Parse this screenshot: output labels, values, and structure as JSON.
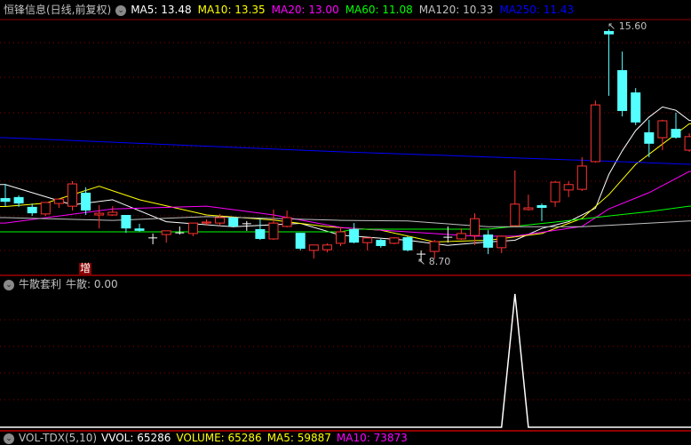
{
  "main_header": {
    "title": "恒锋信息(日线,前复权)",
    "ma": [
      {
        "label": "MA5: 13.48",
        "color": "#ffffff"
      },
      {
        "label": "MA10: 13.35",
        "color": "#ffff00"
      },
      {
        "label": "MA20: 13.00",
        "color": "#ff00ff"
      },
      {
        "label": "MA60: 11.08",
        "color": "#00ff00"
      },
      {
        "label": "MA120: 10.33",
        "color": "#c0c0c0"
      },
      {
        "label": "MA250: 11.43",
        "color": "#0000ff"
      }
    ]
  },
  "indicator_header": {
    "title": "牛散套利",
    "value": "牛散: 0.00"
  },
  "volume_header": {
    "title": "VOL-TDX(5,10)",
    "items": [
      {
        "label": "VVOL: 65286",
        "color": "#ffffff"
      },
      {
        "label": "VOLUME: 65286",
        "color": "#ffff00"
      },
      {
        "label": "MA5: 59887",
        "color": "#ffff00"
      },
      {
        "label": "MA10: 73873",
        "color": "#ff00ff"
      }
    ]
  },
  "marker": "增",
  "chart_data": [
    {
      "type": "candlestick",
      "high_label": "15.60",
      "low_label": "8.70",
      "colors": {
        "up": "#ff3232",
        "down": "#54ffff",
        "flat": "#ffffff",
        "grid": "#8b0000"
      },
      "ohlc": [
        [
          10.6,
          11.02,
          10.36,
          10.49
        ],
        [
          10.63,
          10.68,
          10.34,
          10.44
        ],
        [
          10.34,
          10.44,
          10.07,
          10.15
        ],
        [
          10.13,
          10.47,
          10.07,
          10.47
        ],
        [
          10.44,
          10.57,
          10.31,
          10.57
        ],
        [
          10.36,
          11.1,
          10.23,
          11.02
        ],
        [
          10.76,
          10.92,
          10.1,
          10.23
        ],
        [
          10.1,
          10.39,
          9.7,
          10.15
        ],
        [
          10.1,
          10.36,
          10.07,
          10.18
        ],
        [
          10.1,
          10.1,
          9.57,
          9.7
        ],
        [
          9.7,
          9.84,
          9.6,
          9.63
        ],
        [
          9.42,
          9.55,
          9.23,
          9.42
        ],
        [
          9.52,
          9.63,
          9.28,
          9.63
        ],
        [
          9.57,
          9.76,
          9.52,
          9.57
        ],
        [
          9.55,
          9.86,
          9.47,
          9.86
        ],
        [
          9.86,
          9.97,
          9.78,
          9.89
        ],
        [
          9.86,
          10.13,
          9.78,
          10.02
        ],
        [
          10.02,
          10.05,
          9.73,
          9.76
        ],
        [
          9.84,
          9.92,
          9.63,
          9.84
        ],
        [
          9.68,
          10.0,
          9.36,
          9.39
        ],
        [
          9.39,
          10.26,
          9.36,
          9.86
        ],
        [
          9.76,
          10.23,
          9.73,
          10.02
        ],
        [
          9.57,
          9.57,
          9.05,
          9.1
        ],
        [
          9.05,
          9.21,
          8.81,
          9.21
        ],
        [
          9.07,
          9.26,
          8.99,
          9.21
        ],
        [
          9.26,
          9.73,
          9.18,
          9.6
        ],
        [
          9.68,
          9.86,
          9.26,
          9.28
        ],
        [
          9.28,
          9.42,
          9.05,
          9.42
        ],
        [
          9.36,
          9.39,
          9.13,
          9.18
        ],
        [
          9.26,
          9.44,
          9.23,
          9.42
        ],
        [
          9.44,
          9.47,
          9.02,
          9.05
        ],
        [
          8.94,
          9.05,
          8.7,
          8.94
        ],
        [
          9.02,
          9.36,
          8.81,
          9.31
        ],
        [
          9.44,
          9.76,
          9.28,
          9.44
        ],
        [
          9.39,
          9.7,
          9.36,
          9.55
        ],
        [
          9.49,
          10.15,
          9.21,
          9.99
        ],
        [
          9.52,
          9.65,
          8.94,
          9.13
        ],
        [
          9.13,
          9.49,
          8.97,
          9.47
        ],
        [
          9.78,
          11.42,
          9.78,
          10.42
        ],
        [
          10.26,
          10.7,
          10.23,
          10.31
        ],
        [
          10.39,
          10.44,
          9.92,
          10.31
        ],
        [
          10.49,
          11.1,
          10.34,
          11.07
        ],
        [
          10.84,
          11.1,
          10.63,
          11.0
        ],
        [
          10.86,
          11.81,
          10.81,
          11.55
        ],
        [
          11.68,
          13.49,
          11.65,
          13.36
        ],
        [
          15.55,
          15.6,
          13.63,
          15.45
        ],
        [
          14.39,
          14.94,
          13.02,
          13.18
        ],
        [
          13.73,
          13.86,
          12.76,
          12.84
        ],
        [
          12.55,
          12.92,
          11.81,
          12.21
        ],
        [
          12.39,
          12.92,
          12.02,
          12.89
        ],
        [
          12.65,
          13.13,
          12.36,
          12.39
        ],
        [
          12.02,
          12.52,
          11.97,
          12.42
        ]
      ],
      "ma_lines": [
        {
          "name": "MA5",
          "color": "#ffffff",
          "points": [
            [
              0,
              11.0
            ],
            [
              5,
              10.4
            ],
            [
              8,
              10.55
            ],
            [
              12,
              9.9
            ],
            [
              17,
              9.75
            ],
            [
              22,
              9.85
            ],
            [
              25,
              9.5
            ],
            [
              30,
              9.35
            ],
            [
              33,
              9.2
            ],
            [
              36,
              9.3
            ],
            [
              38,
              9.35
            ],
            [
              40,
              9.7
            ],
            [
              42,
              9.9
            ],
            [
              44,
              10.3
            ],
            [
              45,
              11.3
            ],
            [
              46,
              12.0
            ],
            [
              47,
              12.6
            ],
            [
              48,
              13.0
            ],
            [
              49,
              13.3
            ],
            [
              50,
              13.2
            ],
            [
              51,
              12.9
            ]
          ]
        },
        {
          "name": "MA10",
          "color": "#ffff00",
          "points": [
            [
              0,
              10.35
            ],
            [
              3,
              10.45
            ],
            [
              7,
              10.95
            ],
            [
              10,
              10.55
            ],
            [
              15,
              10.1
            ],
            [
              20,
              9.95
            ],
            [
              24,
              9.75
            ],
            [
              28,
              9.65
            ],
            [
              32,
              9.3
            ],
            [
              36,
              9.35
            ],
            [
              40,
              9.55
            ],
            [
              43,
              10.0
            ],
            [
              45,
              10.7
            ],
            [
              47,
              11.6
            ],
            [
              49,
              12.2
            ],
            [
              51,
              12.8
            ]
          ]
        },
        {
          "name": "MA20",
          "color": "#ff00ff",
          "points": [
            [
              0,
              9.86
            ],
            [
              8,
              10.28
            ],
            [
              15,
              10.36
            ],
            [
              20,
              10.1
            ],
            [
              25,
              9.73
            ],
            [
              30,
              9.6
            ],
            [
              35,
              9.47
            ],
            [
              38,
              9.47
            ],
            [
              43,
              9.76
            ],
            [
              45,
              10.28
            ],
            [
              48,
              10.76
            ],
            [
              51,
              11.39
            ]
          ]
        },
        {
          "name": "MA60",
          "color": "#00ff00",
          "points": [
            [
              0,
              9.6
            ],
            [
              25,
              9.6
            ],
            [
              26,
              9.68
            ],
            [
              36,
              9.68
            ],
            [
              41,
              9.89
            ],
            [
              45,
              10.07
            ],
            [
              48,
              10.2
            ],
            [
              51,
              10.36
            ]
          ]
        },
        {
          "name": "MA120",
          "color": "#c0c0c0",
          "points": [
            [
              0,
              10.02
            ],
            [
              8,
              9.94
            ],
            [
              15,
              10.05
            ],
            [
              25,
              9.94
            ],
            [
              30,
              9.92
            ],
            [
              36,
              9.75
            ],
            [
              43,
              9.75
            ],
            [
              51,
              9.92
            ]
          ]
        },
        {
          "name": "MA250",
          "color": "#0000ff",
          "points": [
            [
              0,
              12.39
            ],
            [
              25,
              11.97
            ],
            [
              43,
              11.72
            ],
            [
              51,
              11.6
            ]
          ]
        }
      ]
    },
    {
      "type": "line",
      "name": "牛散",
      "values": [
        0,
        0,
        0,
        0,
        0,
        0,
        0,
        0,
        0,
        0,
        0,
        0,
        0,
        0,
        0,
        0,
        0,
        0,
        0,
        0,
        0,
        0,
        0,
        0,
        0,
        0,
        0,
        0,
        0,
        0,
        0,
        0,
        0,
        0,
        0,
        0,
        0,
        0,
        1,
        0,
        0,
        0,
        0,
        0,
        0,
        0,
        0,
        0,
        0,
        0,
        0,
        0
      ],
      "color": "#ffffff"
    }
  ]
}
